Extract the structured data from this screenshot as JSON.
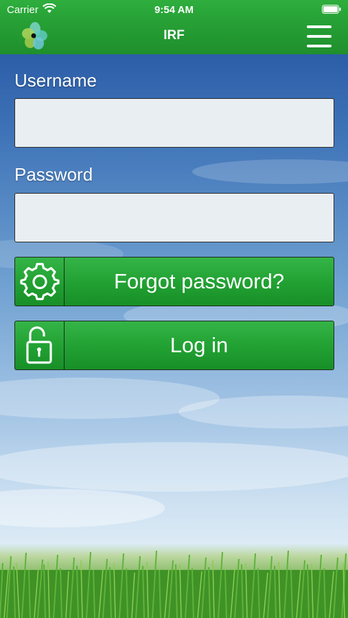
{
  "status_bar": {
    "carrier": "Carrier",
    "time": "9:54 AM"
  },
  "nav": {
    "title": "IRF",
    "logo_icon": "irf-flower-logo",
    "menu_icon": "hamburger-menu-icon"
  },
  "form": {
    "username_label": "Username",
    "username_value": "",
    "password_label": "Password",
    "password_value": "",
    "forgot_button": {
      "label": "Forgot password?",
      "icon": "gear-icon"
    },
    "login_button": {
      "label": "Log in",
      "icon": "unlocked-padlock-icon"
    }
  },
  "colors": {
    "primary_green": "#21a032",
    "nav_green": "#27a236",
    "sky_blue": "#3f74b8"
  }
}
